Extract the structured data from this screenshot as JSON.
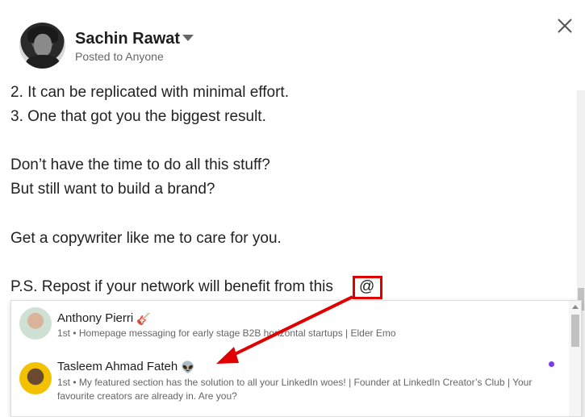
{
  "header": {
    "user_name": "Sachin Rawat",
    "visibility": "Posted to Anyone"
  },
  "post": {
    "lines": [
      "2. It can be replicated with minimal effort.",
      "3. One that got you the biggest result.",
      "Don’t have the time to do all this stuff?",
      "But still want to build a brand?",
      "Get a copywriter like me to care for you.",
      "P.S. Repost if your network will benefit from this",
      "@"
    ]
  },
  "mentions": [
    {
      "name": "Anthony Pierri",
      "emoji": "🎸",
      "desc": "1st • Homepage messaging for early stage B2B horizontal startups | Elder Emo"
    },
    {
      "name": "Tasleem Ahmad Fateh",
      "emoji": "👽",
      "desc": "1st • My featured section has the solution to all your LinkedIn woes! | Founder at LinkedIn Creator’s Club | Your favourite creators are already in. Are you?"
    }
  ],
  "colors": {
    "annotation_red": "#e00000",
    "unread_dot": "#7a3cf0"
  },
  "icons": [
    "caret-down-icon",
    "close-icon",
    "scroll-up-icon"
  ]
}
